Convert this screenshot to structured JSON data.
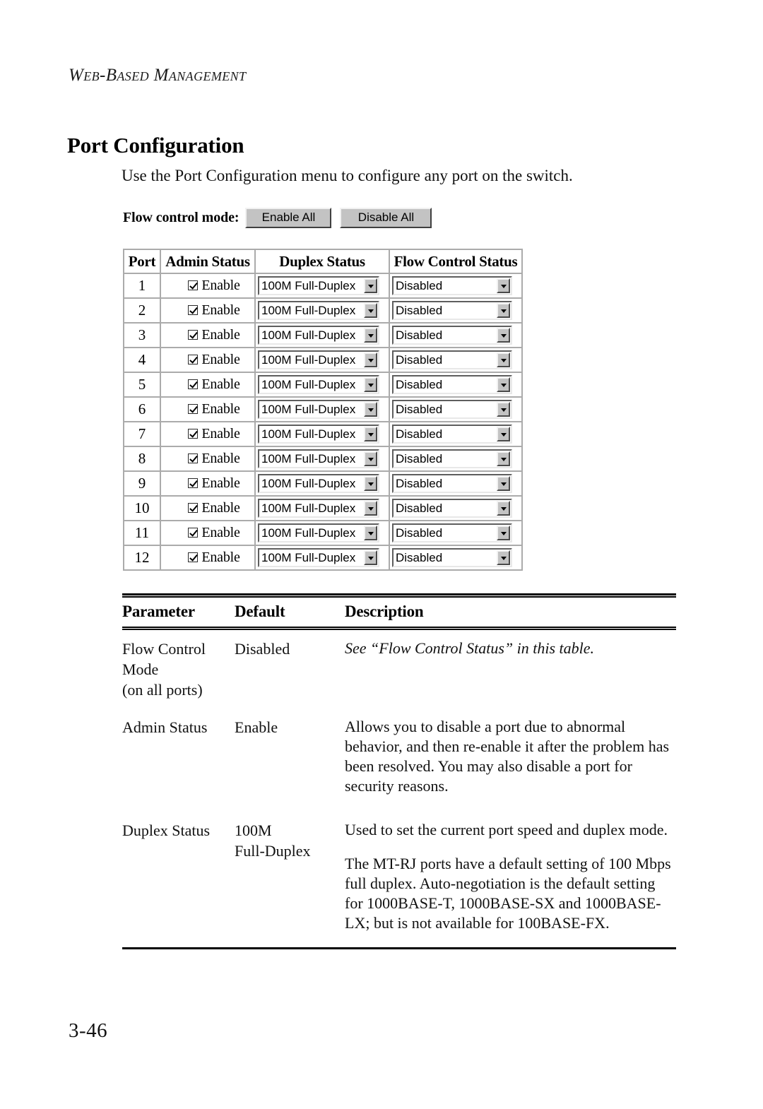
{
  "running_header": "Web-Based Management",
  "section": {
    "title": "Port Configuration",
    "intro": "Use the Port Configuration menu to configure any port on the switch."
  },
  "flow_control_bar": {
    "label": "Flow control mode:",
    "enable_all_label": "Enable All",
    "disable_all_label": "Disable All"
  },
  "port_table": {
    "headers": {
      "port": "Port",
      "admin_status": "Admin Status",
      "duplex_status": "Duplex Status",
      "flow_control_status": "Flow Control Status"
    },
    "admin_checkbox_label": "Enable",
    "duplex_value": "100M Full-Duplex",
    "flow_value": "Disabled",
    "rows": [
      {
        "port": "1",
        "admin": "Enable",
        "admin_checked": true,
        "duplex": "100M Full-Duplex",
        "flow": "Disabled"
      },
      {
        "port": "2",
        "admin": "Enable",
        "admin_checked": true,
        "duplex": "100M Full-Duplex",
        "flow": "Disabled"
      },
      {
        "port": "3",
        "admin": "Enable",
        "admin_checked": true,
        "duplex": "100M Full-Duplex",
        "flow": "Disabled"
      },
      {
        "port": "4",
        "admin": "Enable",
        "admin_checked": true,
        "duplex": "100M Full-Duplex",
        "flow": "Disabled"
      },
      {
        "port": "5",
        "admin": "Enable",
        "admin_checked": true,
        "duplex": "100M Full-Duplex",
        "flow": "Disabled"
      },
      {
        "port": "6",
        "admin": "Enable",
        "admin_checked": true,
        "duplex": "100M Full-Duplex",
        "flow": "Disabled"
      },
      {
        "port": "7",
        "admin": "Enable",
        "admin_checked": true,
        "duplex": "100M Full-Duplex",
        "flow": "Disabled"
      },
      {
        "port": "8",
        "admin": "Enable",
        "admin_checked": true,
        "duplex": "100M Full-Duplex",
        "flow": "Disabled"
      },
      {
        "port": "9",
        "admin": "Enable",
        "admin_checked": true,
        "duplex": "100M Full-Duplex",
        "flow": "Disabled"
      },
      {
        "port": "10",
        "admin": "Enable",
        "admin_checked": true,
        "duplex": "100M Full-Duplex",
        "flow": "Disabled"
      },
      {
        "port": "11",
        "admin": "Enable",
        "admin_checked": true,
        "duplex": "100M Full-Duplex",
        "flow": "Disabled"
      },
      {
        "port": "12",
        "admin": "Enable",
        "admin_checked": true,
        "duplex": "100M Full-Duplex",
        "flow": "Disabled"
      }
    ]
  },
  "param_table": {
    "headers": {
      "parameter": "Parameter",
      "default": "Default",
      "description": "Description"
    },
    "rows": [
      {
        "parameter": "Flow Control\nMode\n(on all ports)",
        "parameter_lines": [
          "Flow Control",
          "Mode",
          "(on all ports)"
        ],
        "default": "Disabled",
        "default_lines": [
          "Disabled"
        ],
        "description_paragraphs": [
          "See “Flow Control Status” in this table."
        ],
        "description_italic": true
      },
      {
        "parameter": "Admin Status",
        "parameter_lines": [
          "Admin Status"
        ],
        "default": "Enable",
        "default_lines": [
          "Enable"
        ],
        "description_paragraphs": [
          "Allows you to disable a port due to abnormal behavior, and then re-enable it after the problem has been resolved. You may also disable a port for security reasons."
        ],
        "description_italic": false
      },
      {
        "parameter": "Duplex Status",
        "parameter_lines": [
          "Duplex Status"
        ],
        "default": "100M\nFull-Duplex",
        "default_lines": [
          "100M",
          "Full-Duplex"
        ],
        "description_paragraphs": [
          "Used to set the current port speed and duplex mode.",
          "The MT-RJ ports have a default setting of 100 Mbps full duplex. Auto-negotiation is the default setting for 1000BASE-T, 1000BASE-SX and 1000BASE-LX; but is not available for 100BASE-FX."
        ],
        "description_italic": false
      }
    ]
  },
  "footer": {
    "page_number": "3-46"
  }
}
